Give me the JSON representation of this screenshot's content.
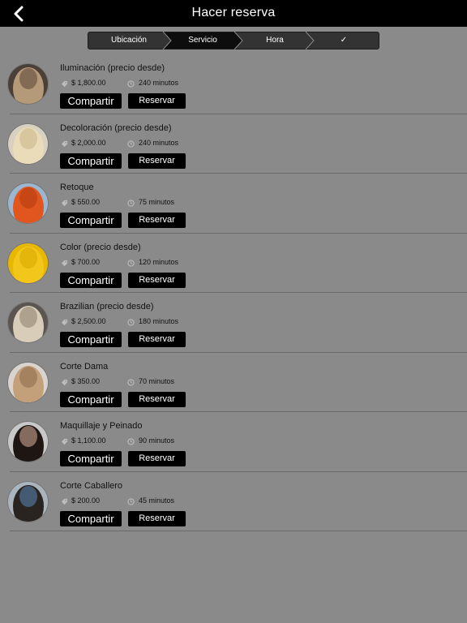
{
  "header": {
    "title": "Hacer reserva",
    "back_icon": "chevron-left-icon"
  },
  "steps": [
    {
      "label": "Ubicación",
      "active": false
    },
    {
      "label": "Servicio",
      "active": true
    },
    {
      "label": "Hora",
      "active": false
    },
    {
      "label": "✓",
      "active": false
    }
  ],
  "colors": {
    "background": "#8a8a8a",
    "bar": "#000000",
    "button": "#000000"
  },
  "services": [
    {
      "name": "Iluminación (precio desde)",
      "price": "$ 1,800.00",
      "duration": "240 minutos",
      "share_label": "Compartir",
      "book_label": "Reservar",
      "hair": "#b59a7a",
      "hair2": "#5a4332",
      "bg": "#4a4038"
    },
    {
      "name": "Decoloración (precio desde)",
      "price": "$ 2,000.00",
      "duration": "240 minutos",
      "share_label": "Compartir",
      "book_label": "Reservar",
      "hair": "#eadcb8",
      "hair2": "#c9b48a",
      "bg": "#d8d0c0"
    },
    {
      "name": "Retoque",
      "price": "$ 550.00",
      "duration": "75 minutos",
      "share_label": "Compartir",
      "book_label": "Reservar",
      "hair": "#e0561e",
      "hair2": "#b33a10",
      "bg": "#9ab6d0"
    },
    {
      "name": "Color (precio desde)",
      "price": "$ 700.00",
      "duration": "120 minutos",
      "share_label": "Compartir",
      "book_label": "Reservar",
      "hair": "#f2c61a",
      "hair2": "#d9a800",
      "bg": "#e8b800"
    },
    {
      "name": "Brazilian (precio desde)",
      "price": "$ 2,500.00",
      "duration": "180 minutos",
      "share_label": "Compartir",
      "book_label": "Reservar",
      "hair": "#d8cdb8",
      "hair2": "#8c7f6c",
      "bg": "#5a5550"
    },
    {
      "name": "Corte Dama",
      "price": "$ 350.00",
      "duration": "70 minutos",
      "share_label": "Compartir",
      "book_label": "Reservar",
      "hair": "#c4a07a",
      "hair2": "#8a6a4a",
      "bg": "#d9d4cf"
    },
    {
      "name": "Maquillaje y Peinado",
      "price": "$ 1,100.00",
      "duration": "90 minutos",
      "share_label": "Compartir",
      "book_label": "Reservar",
      "hair": "#1e1612",
      "hair2": "#d9b39a",
      "bg": "#c8c8c8"
    },
    {
      "name": "Corte Caballero",
      "price": "$ 200.00",
      "duration": "45 minutos",
      "share_label": "Compartir",
      "book_label": "Reservar",
      "hair": "#2a2420",
      "hair2": "#5b86b8",
      "bg": "#aab4bc"
    }
  ]
}
